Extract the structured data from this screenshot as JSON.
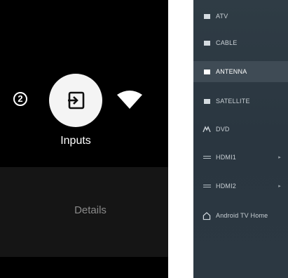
{
  "left_panel": {
    "badge_count": "2",
    "inputs_label": "Inputs",
    "details_label": "Details",
    "inputs_icon": "input-source-icon",
    "network_icon": "wifi-icon"
  },
  "right_panel": {
    "items": [
      {
        "label": "ATV",
        "icon": "tv-icon",
        "selected": false
      },
      {
        "label": "CABLE",
        "icon": "tv-icon",
        "selected": false
      },
      {
        "label": "ANTENNA",
        "icon": "tv-icon",
        "selected": true
      },
      {
        "label": "SATELLITE",
        "icon": "tv-icon",
        "selected": false
      },
      {
        "label": "DVD",
        "icon": "dvd-icon",
        "selected": false
      },
      {
        "label": "HDMI1",
        "icon": "hdmi-icon",
        "selected": false
      },
      {
        "label": "HDMI2",
        "icon": "hdmi-icon",
        "selected": false
      },
      {
        "label": "Android TV Home",
        "icon": "home-icon",
        "selected": false
      }
    ]
  },
  "colors": {
    "left_bg": "#000000",
    "right_bg": "#2f3c45",
    "selected_bg": "#3f4b55"
  }
}
